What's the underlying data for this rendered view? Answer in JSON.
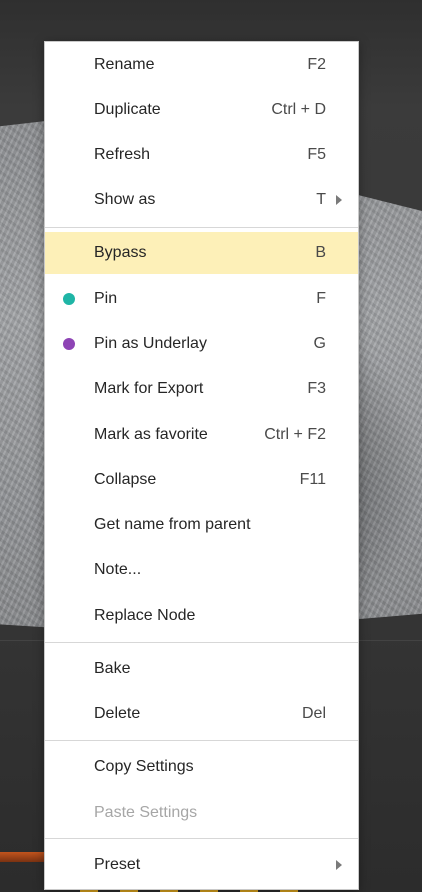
{
  "menu": {
    "rename": {
      "label": "Rename",
      "shortcut": "F2"
    },
    "duplicate": {
      "label": "Duplicate",
      "shortcut": "Ctrl + D"
    },
    "refresh": {
      "label": "Refresh",
      "shortcut": "F5"
    },
    "show_as": {
      "label": "Show as",
      "shortcut": "T"
    },
    "bypass": {
      "label": "Bypass",
      "shortcut": "B"
    },
    "pin": {
      "label": "Pin",
      "shortcut": "F",
      "dot_color": "#1fb5a6"
    },
    "pin_underlay": {
      "label": "Pin as Underlay",
      "shortcut": "G",
      "dot_color": "#8e44b5"
    },
    "mark_export": {
      "label": "Mark for Export",
      "shortcut": "F3"
    },
    "mark_favorite": {
      "label": "Mark as favorite",
      "shortcut": "Ctrl + F2"
    },
    "collapse": {
      "label": "Collapse",
      "shortcut": "F11"
    },
    "name_from_parent": {
      "label": "Get name from parent"
    },
    "note": {
      "label": "Note..."
    },
    "replace_node": {
      "label": "Replace Node"
    },
    "bake": {
      "label": "Bake"
    },
    "delete": {
      "label": "Delete",
      "shortcut": "Del"
    },
    "copy_settings": {
      "label": "Copy Settings"
    },
    "paste_settings": {
      "label": "Paste Settings"
    },
    "preset": {
      "label": "Preset"
    }
  },
  "colors": {
    "highlight": "#fdf0b8",
    "menu_bg": "#ffffff",
    "disabled_text": "#a6a6a6"
  },
  "icons": {
    "submenu": "chevron-right-icon"
  }
}
